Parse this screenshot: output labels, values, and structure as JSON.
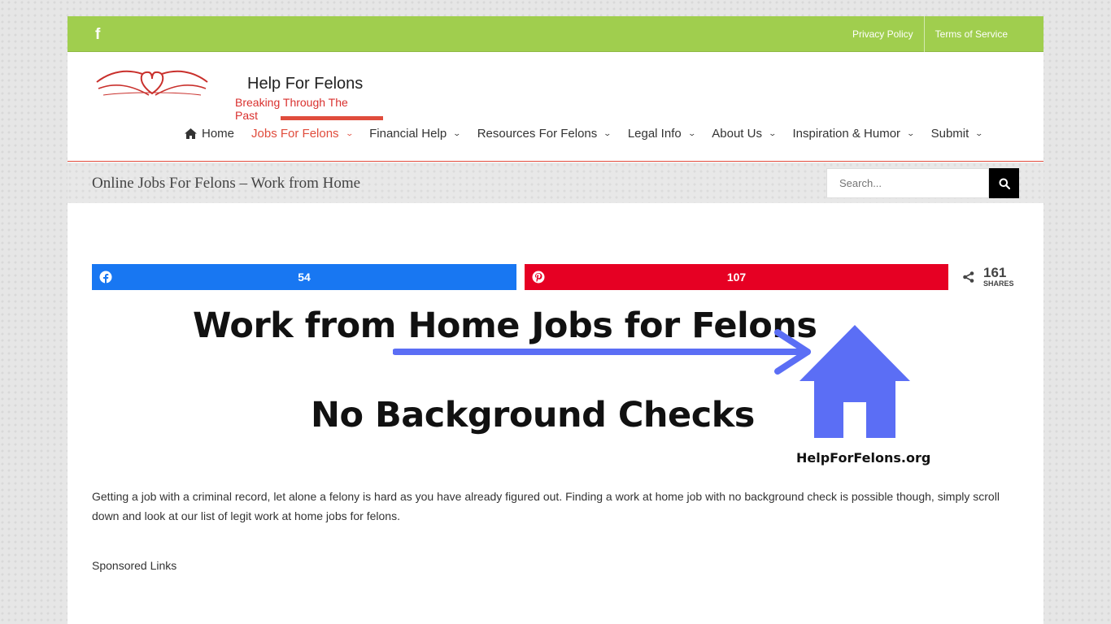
{
  "topbar": {
    "social_icon": "facebook-icon",
    "links": [
      "Privacy Policy",
      "Terms of Service"
    ]
  },
  "logo": {
    "title": "Help For Felons",
    "tagline": "Breaking Through The Past"
  },
  "nav": {
    "items": [
      {
        "label": "Home",
        "icon": "home-icon",
        "dropdown": false
      },
      {
        "label": "Jobs For Felons",
        "dropdown": true,
        "active": true
      },
      {
        "label": "Financial Help",
        "dropdown": true
      },
      {
        "label": "Resources For Felons",
        "dropdown": true
      },
      {
        "label": "Legal Info",
        "dropdown": true
      },
      {
        "label": "About Us",
        "dropdown": true
      },
      {
        "label": "Inspiration & Humor",
        "dropdown": true
      },
      {
        "label": "Submit",
        "dropdown": true
      }
    ]
  },
  "page": {
    "title": "Online Jobs For Felons – Work from Home"
  },
  "search": {
    "placeholder": "Search..."
  },
  "share": {
    "facebook_count": "54",
    "pinterest_count": "107",
    "total": "161",
    "total_label": "SHARES"
  },
  "hero": {
    "line1": "Work from Home Jobs for Felons",
    "line2": "No Background Checks",
    "site": "HelpForFelons.org"
  },
  "content": {
    "paragraph": "Getting a job with a criminal record, let alone a felony is hard as you have already figured out. Finding a work at home job with no background check is possible though, simply scroll down and look at our list of legit work at home jobs for felons.",
    "sponsored": "Sponsored Links"
  },
  "colors": {
    "topbar": "#a0ce4e",
    "accent": "#e04c3c",
    "facebook": "#1877f2",
    "pinterest": "#e60023",
    "hero_blue": "#5b6ef5"
  }
}
